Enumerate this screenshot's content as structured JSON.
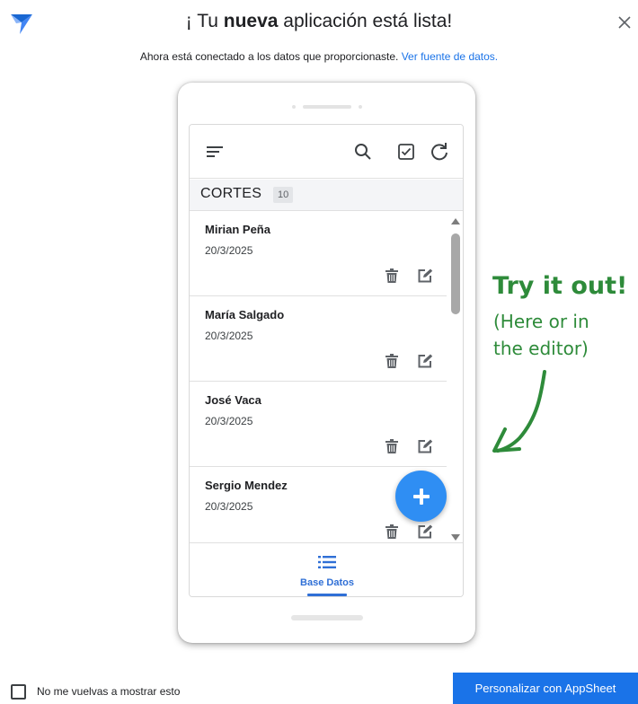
{
  "dialog": {
    "title_pre": "¡ Tu ",
    "title_bold": "nueva",
    "title_post": " aplicación está lista!",
    "subtitle_text": "Ahora está conectado a los datos que proporcionaste. ",
    "subtitle_link": "Ver fuente de datos."
  },
  "app": {
    "section_title": "CORTES",
    "section_count": "10",
    "records": [
      {
        "name": "Mirian Peña",
        "date": "20/3/2025"
      },
      {
        "name": "María Salgado",
        "date": "20/3/2025"
      },
      {
        "name": "José Vaca",
        "date": "20/3/2025"
      },
      {
        "name": "Sergio Mendez",
        "date": "20/3/2025"
      }
    ],
    "nav_label": "Base Datos",
    "header_icons": [
      "menu-icon",
      "search-icon",
      "checkbox-icon",
      "refresh-icon"
    ],
    "accent_color": "#2f8ef3"
  },
  "annotation": {
    "headline": "Try it out!",
    "line1": "(Here or in",
    "line2": "the editor)",
    "color": "#2e8b3a"
  },
  "footer": {
    "checkbox_label": "No me vuelvas a mostrar esto",
    "primary_button": "Personalizar con AppSheet",
    "primary_color": "#1a73e8"
  }
}
